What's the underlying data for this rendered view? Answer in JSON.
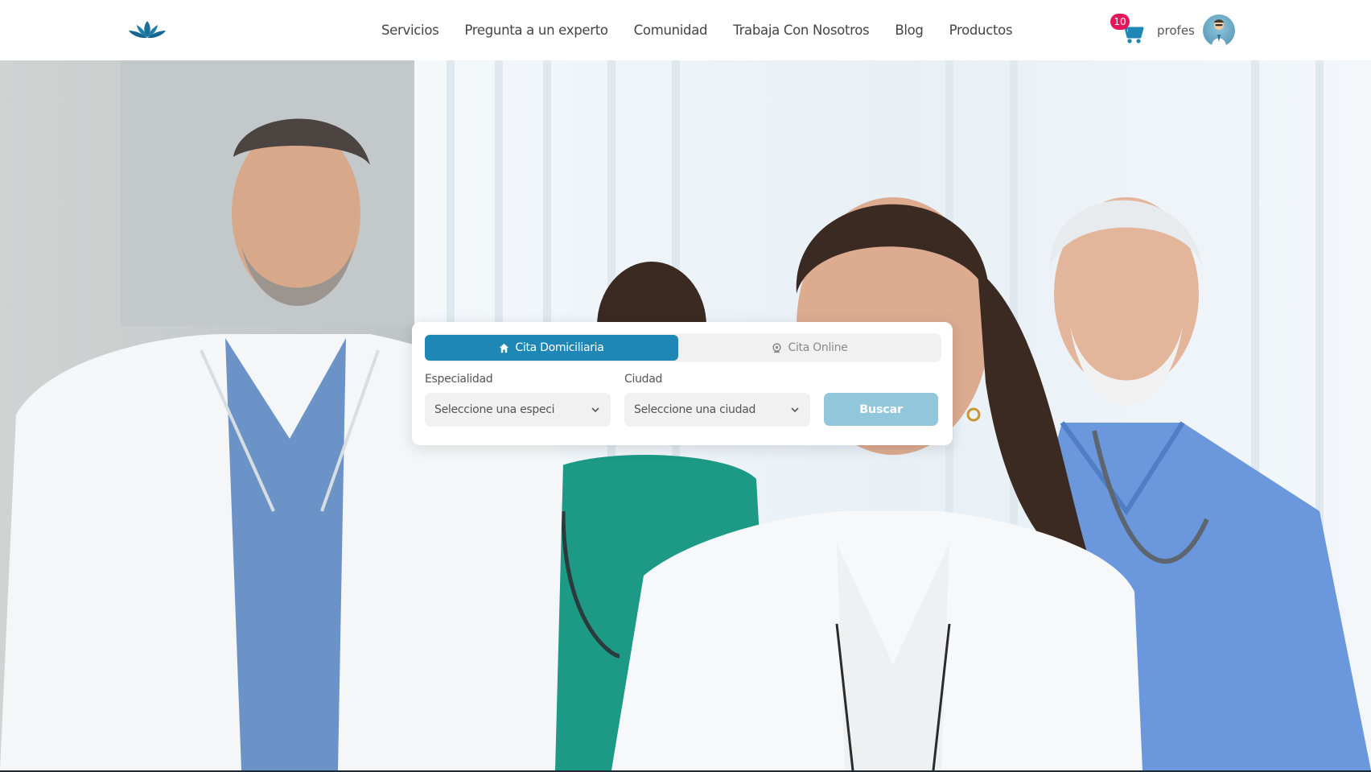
{
  "header": {
    "nav": [
      {
        "label": "Servicios"
      },
      {
        "label": "Pregunta a un experto"
      },
      {
        "label": "Comunidad"
      },
      {
        "label": "Trabaja Con Nosotros"
      },
      {
        "label": "Blog"
      },
      {
        "label": "Productos"
      }
    ],
    "cart_count": "10",
    "username": "profes"
  },
  "search": {
    "tabs": [
      {
        "label": "Cita Domiciliaria",
        "icon": "home-icon",
        "active": true
      },
      {
        "label": "Cita Online",
        "icon": "webcam-icon",
        "active": false
      }
    ],
    "especialidad_label": "Especialidad",
    "especialidad_placeholder": "Seleccione una especi",
    "ciudad_label": "Ciudad",
    "ciudad_placeholder": "Seleccione una ciudad",
    "button_label": "Buscar"
  },
  "colors": {
    "accent": "#1f87b5",
    "button_disabled": "#92c6da",
    "badge": "#e6165d",
    "logo": "#1b6f9a"
  }
}
